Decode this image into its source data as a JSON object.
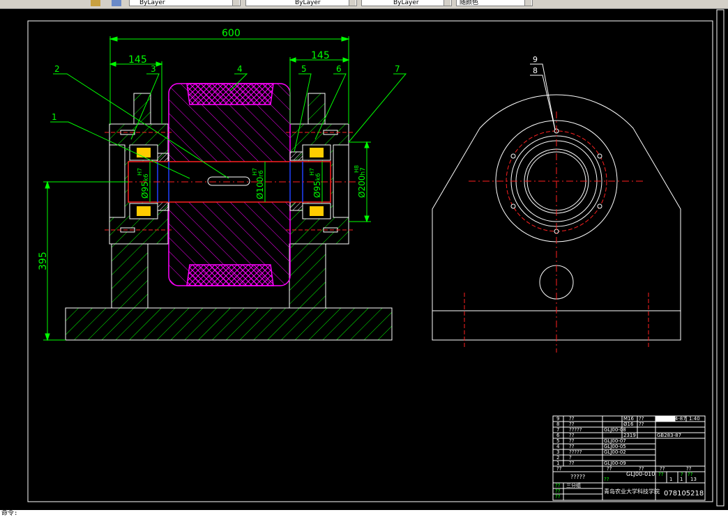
{
  "toolbar": {
    "layer_1": "ByLayer",
    "layer_2": "ByLayer",
    "layer_3": "ByLayer",
    "plot_style": "随颜色"
  },
  "dimensions": {
    "total_width": "600",
    "left_width": "145",
    "right_width": "145",
    "height": "395",
    "dia_left": "Ø95",
    "fit_left": "k6",
    "dia_center": "Ø100",
    "fit_center": "r6",
    "dia_right": "Ø95",
    "fit_right": "k6",
    "dia_bore": "Ø200",
    "fit_bore": "h7",
    "hub_left": "H7",
    "hub_center": "H7",
    "hub_right": "H7",
    "bore_tol": "H8"
  },
  "balloons": [
    "1",
    "2",
    "3",
    "4",
    "5",
    "6",
    "7",
    "8",
    "9"
  ],
  "title_block": {
    "parts": [
      {
        "no": "9",
        "name": "??",
        "code": "",
        "std": "GB/T244-87",
        "qty": "",
        "mat": "M16",
        "note": "??"
      },
      {
        "no": "8",
        "name": "??",
        "code": "",
        "std": "",
        "qty": "",
        "mat": "Ø16",
        "note": "??"
      },
      {
        "no": "7",
        "name": "?????",
        "code": "GLJ00-08",
        "std": "",
        "qty": "",
        "mat": "",
        "note": ""
      },
      {
        "no": "6",
        "name": "??",
        "code": "",
        "std": "GB283-87",
        "qty": "",
        "mat": "2319",
        "note": ""
      },
      {
        "no": "5",
        "name": "??",
        "code": "GLJ00-07",
        "std": "",
        "qty": "",
        "mat": "",
        "note": ""
      },
      {
        "no": "4",
        "name": "??",
        "code": "GLJ00-05",
        "std": "",
        "qty": "",
        "mat": "",
        "note": ""
      },
      {
        "no": "3",
        "name": "?????",
        "code": "GLJ00-02",
        "std": "",
        "qty": "",
        "mat": "",
        "note": ""
      },
      {
        "no": "2",
        "name": "?",
        "code": "",
        "std": "",
        "qty": "",
        "mat": "",
        "note": ""
      },
      {
        "no": "1",
        "name": "??",
        "code": "GLJ00-09",
        "std": "",
        "qty": "",
        "mat": "",
        "note": ""
      }
    ],
    "scale": "1:40",
    "header_cells": [
      "??",
      "??",
      "??",
      "??",
      "??"
    ],
    "assembly_name": "?????",
    "drawing_code": "GLJ00-010",
    "sheet_cells": [
      "??",
      "??",
      "?",
      "??"
    ],
    "sheet_values": [
      "1",
      "1",
      "13"
    ],
    "designer_labels": [
      "??",
      "??",
      "??"
    ],
    "designer_note": "三分组",
    "school": "青岛农业大学科技学院",
    "student_id": "078105218"
  },
  "command_line": "命令:"
}
